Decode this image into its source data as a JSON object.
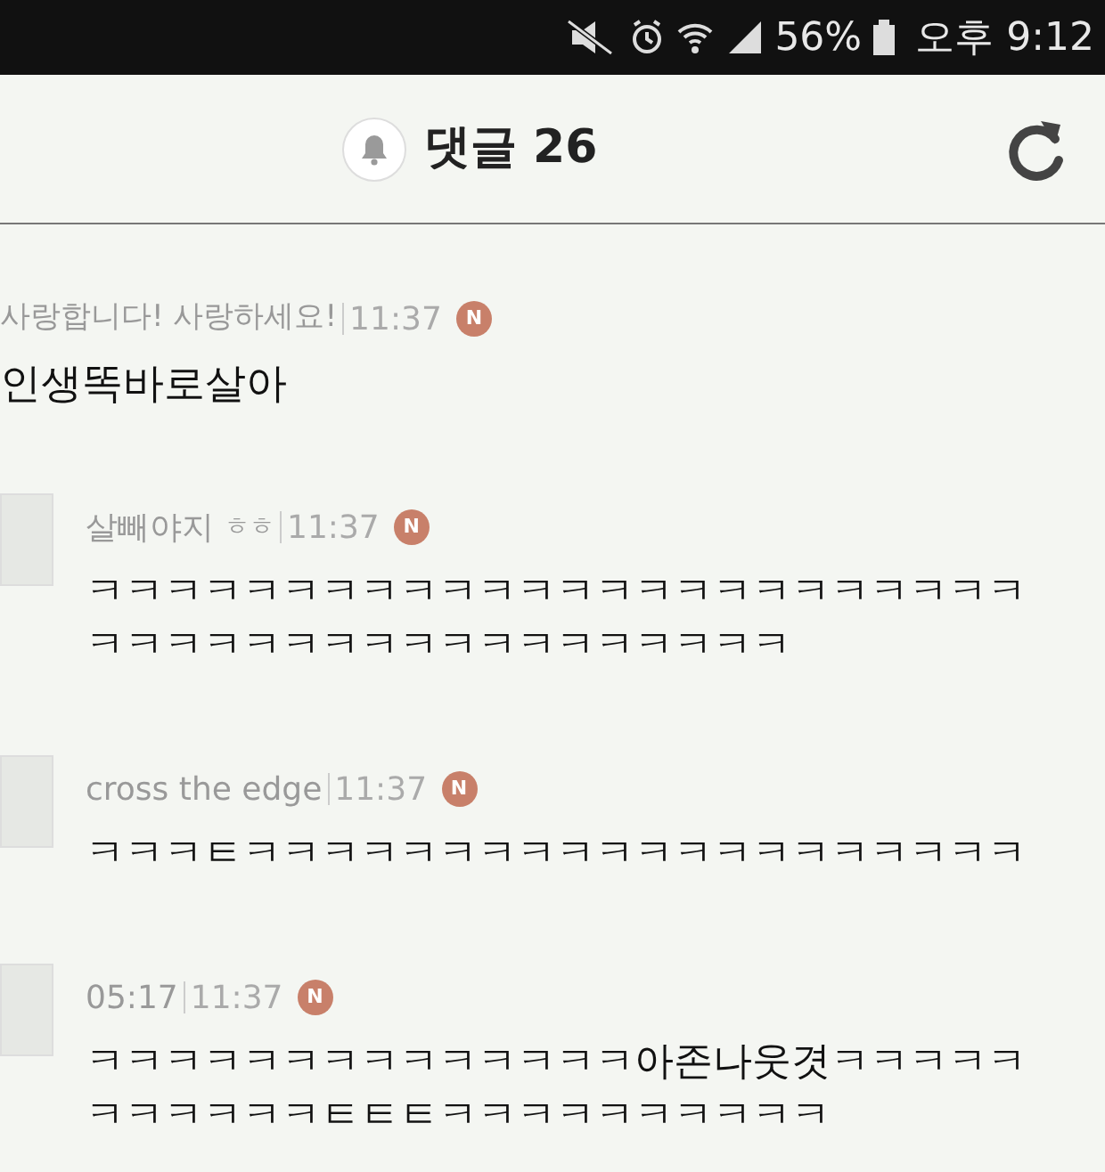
{
  "status_bar": {
    "battery": "56%",
    "time": "오후 9:12"
  },
  "header": {
    "title": "댓글 26"
  },
  "comments": [
    {
      "avatar": false,
      "author": "사랑합니다! 사랑하세요!",
      "time": "11:37",
      "badge": "N",
      "lines": [
        "인생똑바로살아"
      ]
    },
    {
      "avatar": true,
      "author": "살빼야지",
      "tag": "ㅎㅎ",
      "time": "11:37",
      "badge": "N",
      "lines": [
        "ㅋㅋㅋㅋㅋㅋㅋㅋㅋㅋㅋㅋㅋㅋㅋㅋㅋㅋㅋㅋㅋㅋㅋㅋ",
        "ㅋㅋㅋㅋㅋㅋㅋㅋㅋㅋㅋㅋㅋㅋㅋㅋㅋㅋ"
      ]
    },
    {
      "avatar": true,
      "author": "cross the edge",
      "time": "11:37",
      "badge": "N",
      "lines": [
        "ㅋㅋㅋㅌㅋㅋㅋㅋㅋㅋㅋㅋㅋㅋㅋㅋㅋㅋㅋㅋㅋㅋㅋㅋ"
      ]
    },
    {
      "avatar": true,
      "author": "05:17",
      "time": "11:37",
      "badge": "N",
      "lines": [
        "ㅋㅋㅋㅋㅋㅋㅋㅋㅋㅋㅋㅋㅋㅋ아존나웃겻ㅋㅋㅋㅋㅋ",
        "ㅋㅋㅋㅋㅋㅋㅌㅌㅌㅋㅋㅋㅋㅋㅋㅋㅋㅋㅋ"
      ]
    }
  ]
}
